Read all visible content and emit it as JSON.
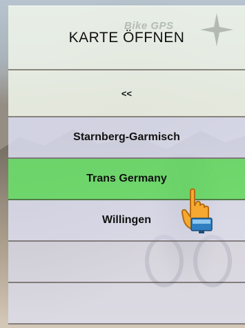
{
  "brand": "Bike GPS",
  "menu": {
    "open_map_label": "KARTE ÖFFNEN",
    "back_label": "<<",
    "routes": [
      {
        "label": "Starnberg-Garmisch",
        "selected": false
      },
      {
        "label": "Trans Germany",
        "selected": true
      },
      {
        "label": "Willingen",
        "selected": false
      }
    ],
    "empty_slots": 2
  },
  "colors": {
    "selected": "#6ade6a",
    "route_bg": "#dee0f4",
    "header_bg": "#eef4e8"
  },
  "icons": [
    "pointing-hand-icon",
    "monitor-icon",
    "star-logo-icon"
  ]
}
